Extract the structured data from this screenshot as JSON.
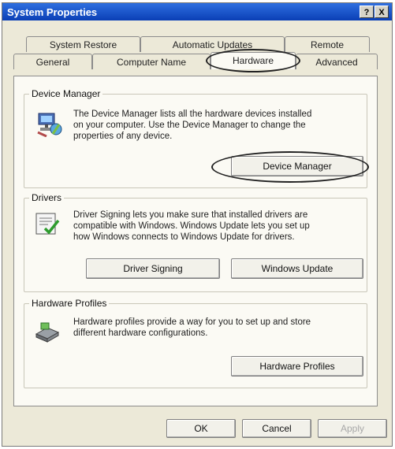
{
  "window": {
    "title": "System Properties",
    "help_button": "?",
    "close_button": "X"
  },
  "tabs": {
    "row1": [
      "System Restore",
      "Automatic Updates",
      "Remote"
    ],
    "row2": [
      "General",
      "Computer Name",
      "Hardware",
      "Advanced"
    ],
    "active": "Hardware"
  },
  "device_manager": {
    "legend": "Device Manager",
    "line1": "The Device Manager lists all the hardware devices installed",
    "line2": "on your computer. Use the Device Manager to change the",
    "line3": "properties of any device.",
    "button": "Device Manager"
  },
  "drivers": {
    "legend": "Drivers",
    "line1": "Driver Signing lets you make sure that installed drivers are",
    "line2": "compatible with Windows. Windows Update lets you set up",
    "line3": "how Windows connects to Windows Update for drivers.",
    "signing_button": "Driver Signing",
    "update_button": "Windows Update"
  },
  "hardware_profiles": {
    "legend": "Hardware Profiles",
    "line1": "Hardware profiles provide a way for you to set up and store",
    "line2": "different hardware configurations.",
    "button": "Hardware Profiles"
  },
  "footer": {
    "ok": "OK",
    "cancel": "Cancel",
    "apply": "Apply"
  }
}
